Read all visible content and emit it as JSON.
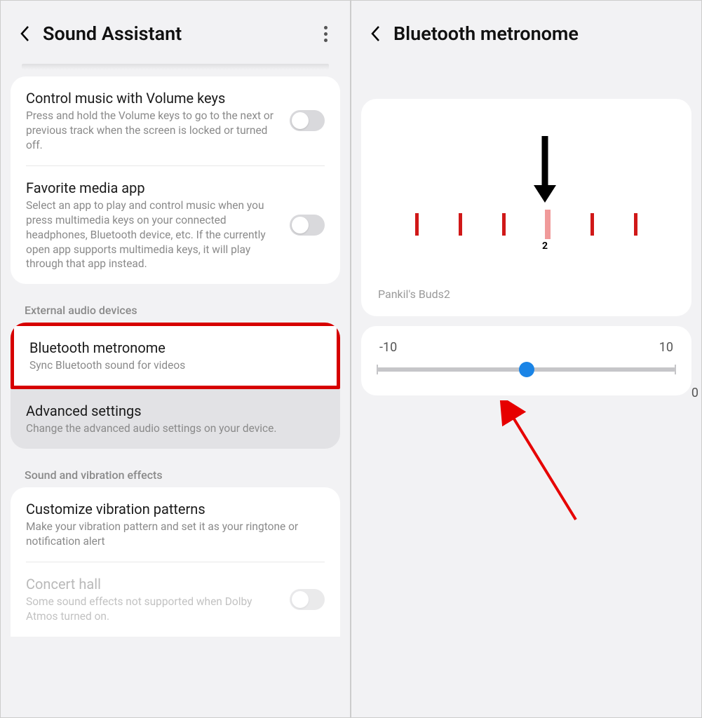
{
  "left": {
    "title": "Sound Assistant",
    "items": {
      "control_music": {
        "title": "Control music with Volume keys",
        "desc": "Press and hold the Volume keys to go to the next or previous track when the screen is locked or turned off."
      },
      "favorite_app": {
        "title": "Favorite media app",
        "desc": "Select an app to play and control music when you press multimedia keys on your connected headphones, Bluetooth device, etc. If the currently open app supports multimedia keys, it will play through that app instead."
      }
    },
    "sections": {
      "external": "External audio devices",
      "sound_vib": "Sound and vibration effects"
    },
    "bt_metronome": {
      "title": "Bluetooth metronome",
      "desc": "Sync Bluetooth sound for videos"
    },
    "advanced": {
      "title": "Advanced settings",
      "desc": "Change the advanced audio settings on your device."
    },
    "vibration": {
      "title": "Customize vibration patterns",
      "desc": "Make your vibration pattern and set it as your ringtone or notification alert"
    },
    "concert": {
      "title": "Concert hall",
      "desc": "Some sound effects not supported when Dolby Atmos turned on."
    }
  },
  "right": {
    "title": "Bluetooth metronome",
    "tick_label": "2",
    "device": "Pankil's Buds2",
    "slider": {
      "min": "-10",
      "max": "10",
      "value": "0"
    }
  }
}
